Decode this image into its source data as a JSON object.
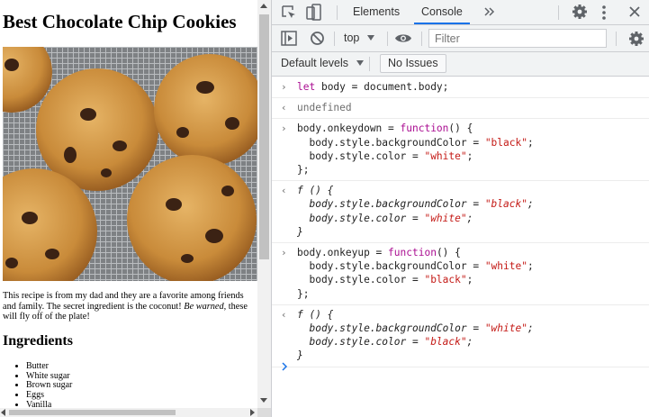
{
  "page": {
    "title": "Best Chocolate Chip Cookies",
    "intro_text": "This recipe is from my dad and they are a favorite among friends and family. The secret ingredient is the coconut! ",
    "intro_emphasis": "Be warned,",
    "intro_tail": " these will fly off of the plate!",
    "ingredients_heading": "Ingredients",
    "ingredients": [
      "Butter",
      "White sugar",
      "Brown sugar",
      "Eggs",
      "Vanilla"
    ]
  },
  "devtools": {
    "tabs": [
      {
        "label": "Elements",
        "selected": false
      },
      {
        "label": "Console",
        "selected": true
      }
    ],
    "context": "top",
    "filter_placeholder": "Filter",
    "default_levels_label": "Default levels",
    "no_issues_label": "No Issues",
    "accent_color": "#1a73e8",
    "console": [
      {
        "kind": "input",
        "lines": [
          "let body = document.body;"
        ]
      },
      {
        "kind": "result",
        "lines": [
          "undefined"
        ]
      },
      {
        "kind": "input",
        "lines": [
          "body.onkeydown = function() {",
          "  body.style.backgroundColor = \"black\";",
          "  body.style.color = \"white\";",
          "};"
        ]
      },
      {
        "kind": "result",
        "lines": [
          "f () {",
          "  body.style.backgroundColor = \"black\";",
          "  body.style.color = \"white\";",
          "}"
        ]
      },
      {
        "kind": "input",
        "lines": [
          "body.onkeyup = function() {",
          "  body.style.backgroundColor = \"white\";",
          "  body.style.color = \"black\";",
          "};"
        ]
      },
      {
        "kind": "result",
        "lines": [
          "f () {",
          "  body.style.backgroundColor = \"white\";",
          "  body.style.color = \"black\";",
          "}"
        ]
      }
    ]
  }
}
